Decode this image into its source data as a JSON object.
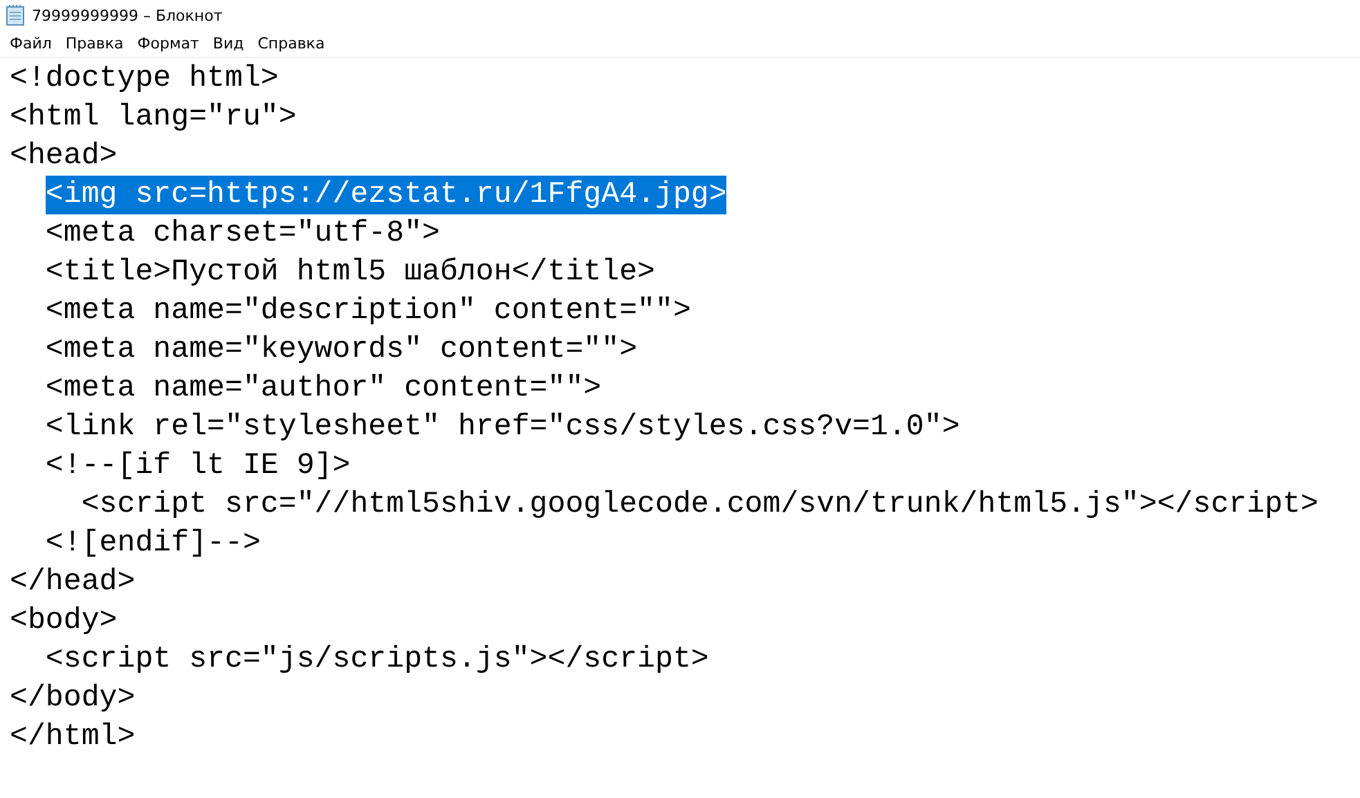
{
  "window": {
    "title": "79999999999 – Блокнот"
  },
  "menu": [
    {
      "label": "Файл"
    },
    {
      "label": "Правка"
    },
    {
      "label": "Формат"
    },
    {
      "label": "Вид"
    },
    {
      "label": "Справка"
    }
  ],
  "editor": {
    "lines": [
      {
        "text": "<!doctype html>",
        "selected": false
      },
      {
        "text": "<html lang=\"ru\">",
        "selected": false
      },
      {
        "text": "<head>",
        "selected": false
      },
      {
        "text": "  <img src=https://ezstat.ru/1FfgA4.jpg>",
        "selected": true
      },
      {
        "text": "  <meta charset=\"utf-8\">",
        "selected": false
      },
      {
        "text": "  <title>Пустой html5 шаблон</title>",
        "selected": false
      },
      {
        "text": "  <meta name=\"description\" content=\"\">",
        "selected": false
      },
      {
        "text": "  <meta name=\"keywords\" content=\"\">",
        "selected": false
      },
      {
        "text": "  <meta name=\"author\" content=\"\">",
        "selected": false
      },
      {
        "text": "  <link rel=\"stylesheet\" href=\"css/styles.css?v=1.0\">",
        "selected": false
      },
      {
        "text": "  <!--[if lt IE 9]>",
        "selected": false
      },
      {
        "text": "    <script src=\"//html5shiv.googlecode.com/svn/trunk/html5.js\"></script>",
        "selected": false
      },
      {
        "text": "  <![endif]-->",
        "selected": false
      },
      {
        "text": "</head>",
        "selected": false
      },
      {
        "text": "<body>",
        "selected": false
      },
      {
        "text": "  <script src=\"js/scripts.js\"></script>",
        "selected": false
      },
      {
        "text": "</body>",
        "selected": false
      },
      {
        "text": "</html>",
        "selected": false
      }
    ]
  }
}
